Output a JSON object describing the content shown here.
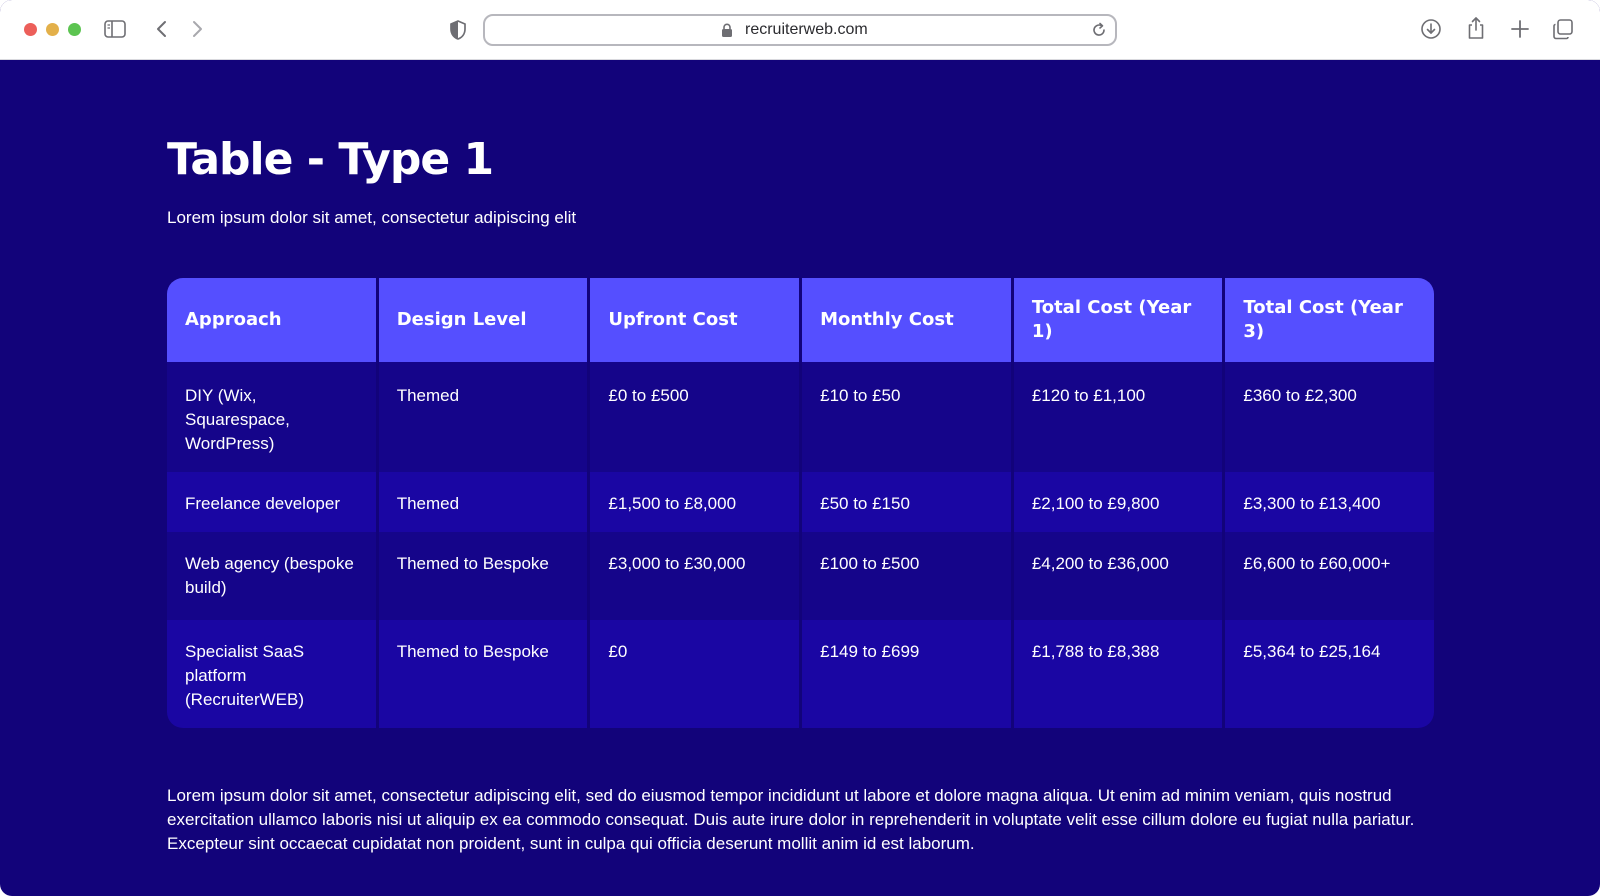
{
  "browser": {
    "url": "recruiterweb.com"
  },
  "page": {
    "title": "Table - Type 1",
    "subtitle": "Lorem ipsum dolor sit amet, consectetur adipiscing elit",
    "body": "Lorem ipsum dolor sit amet, consectetur adipiscing elit, sed do eiusmod tempor incididunt ut labore et dolore magna aliqua. Ut enim ad minim veniam, quis nostrud exercitation ullamco laboris nisi ut aliquip ex ea commodo consequat. Duis aute irure dolor in reprehenderit in voluptate velit esse cillum dolore eu fugiat nulla pariatur. Excepteur sint occaecat cupidatat non proident, sunt in culpa qui officia deserunt mollit anim id est laborum."
  },
  "table": {
    "headers": [
      "Approach",
      "Design Level",
      "Upfront Cost",
      "Monthly Cost",
      "Total Cost (Year 1)",
      "Total Cost (Year 3)"
    ],
    "rows": [
      [
        "DIY (Wix, Squarespace, WordPress)",
        "Themed",
        "£0 to £500",
        "£10 to £50",
        "£120 to £1,100",
        "£360 to £2,300"
      ],
      [
        "Freelance developer",
        "Themed",
        "£1,500 to £8,000",
        "£50 to £150",
        "£2,100 to £9,800",
        "£3,300 to £13,400"
      ],
      [
        "Web agency (bespoke build)",
        "Themed to Bespoke",
        "£3,000 to £30,000",
        "£100 to £500",
        "£4,200 to £36,000",
        "£6,600 to £60,000+"
      ],
      [
        "Specialist SaaS platform (RecruiterWEB)",
        "Themed to Bespoke",
        "£0",
        "£149 to £699",
        "£1,788 to £8,388",
        "£5,364 to £25,164"
      ]
    ]
  },
  "colors": {
    "page_background": "#12037a",
    "header_background": "#554fff",
    "row_dark": "#15058a",
    "row_light": "#1a06a3"
  },
  "icons": [
    "close-dot",
    "minimize-dot",
    "zoom-dot",
    "sidebar-icon",
    "back-icon",
    "forward-icon",
    "shield-icon",
    "lock-icon",
    "reload-icon",
    "download-icon",
    "share-icon",
    "new-tab-icon",
    "tabs-overview-icon"
  ]
}
